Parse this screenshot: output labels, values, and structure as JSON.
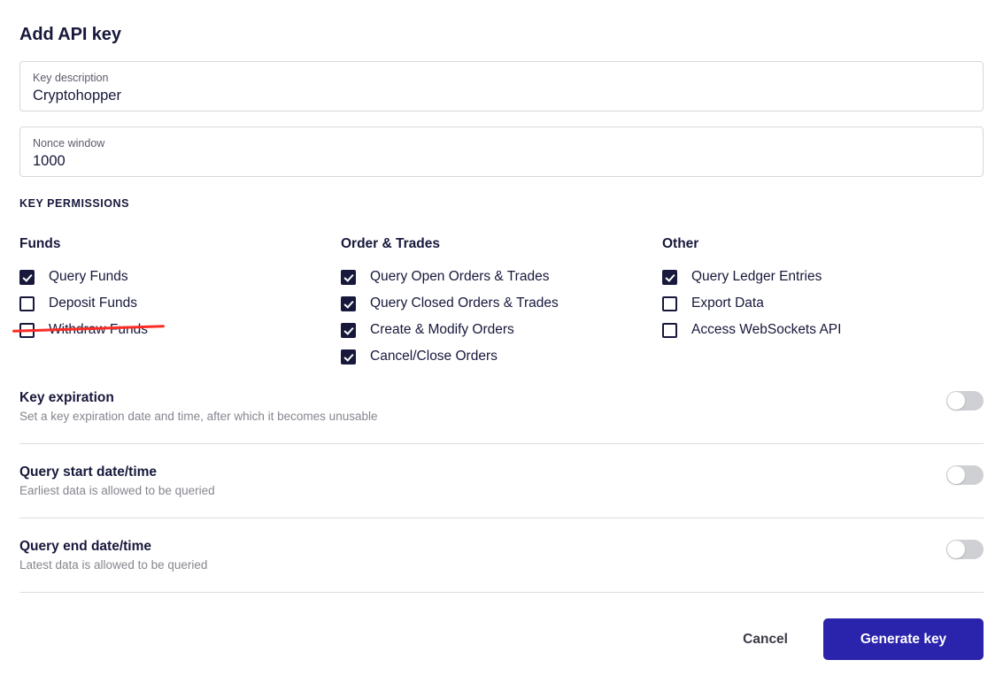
{
  "dialog": {
    "title": "Add API key"
  },
  "fields": [
    {
      "label": "Key description",
      "value": "Cryptohopper"
    },
    {
      "label": "Nonce window",
      "value": "1000"
    }
  ],
  "permissions": {
    "section_label": "KEY PERMISSIONS",
    "columns": [
      {
        "title": "Funds",
        "items": [
          {
            "label": "Query Funds",
            "checked": true,
            "annotated": false
          },
          {
            "label": "Deposit Funds",
            "checked": false,
            "annotated": false
          },
          {
            "label": "Withdraw Funds",
            "checked": false,
            "annotated": true
          }
        ]
      },
      {
        "title": "Order & Trades",
        "items": [
          {
            "label": "Query Open Orders & Trades",
            "checked": true,
            "annotated": false
          },
          {
            "label": "Query Closed Orders & Trades",
            "checked": true,
            "annotated": false
          },
          {
            "label": "Create & Modify Orders",
            "checked": true,
            "annotated": false
          },
          {
            "label": "Cancel/Close Orders",
            "checked": true,
            "annotated": false
          }
        ]
      },
      {
        "title": "Other",
        "items": [
          {
            "label": "Query Ledger Entries",
            "checked": true,
            "annotated": false
          },
          {
            "label": "Export Data",
            "checked": false,
            "annotated": false
          },
          {
            "label": "Access WebSockets API",
            "checked": false,
            "annotated": false
          }
        ]
      }
    ]
  },
  "toggles": [
    {
      "title": "Key expiration",
      "description": "Set a key expiration date and time, after which it becomes unusable",
      "enabled": false
    },
    {
      "title": "Query start date/time",
      "description": "Earliest data is allowed to be queried",
      "enabled": false
    },
    {
      "title": "Query end date/time",
      "description": "Latest data is allowed to be queried",
      "enabled": false
    }
  ],
  "footer": {
    "cancel_label": "Cancel",
    "generate_label": "Generate key"
  },
  "colors": {
    "primary_button": "#2a23ab",
    "ink": "#17183b",
    "annotation_red": "#fb2c25",
    "switch_track_off": "#cfd0d4",
    "muted_text": "#85868f"
  }
}
